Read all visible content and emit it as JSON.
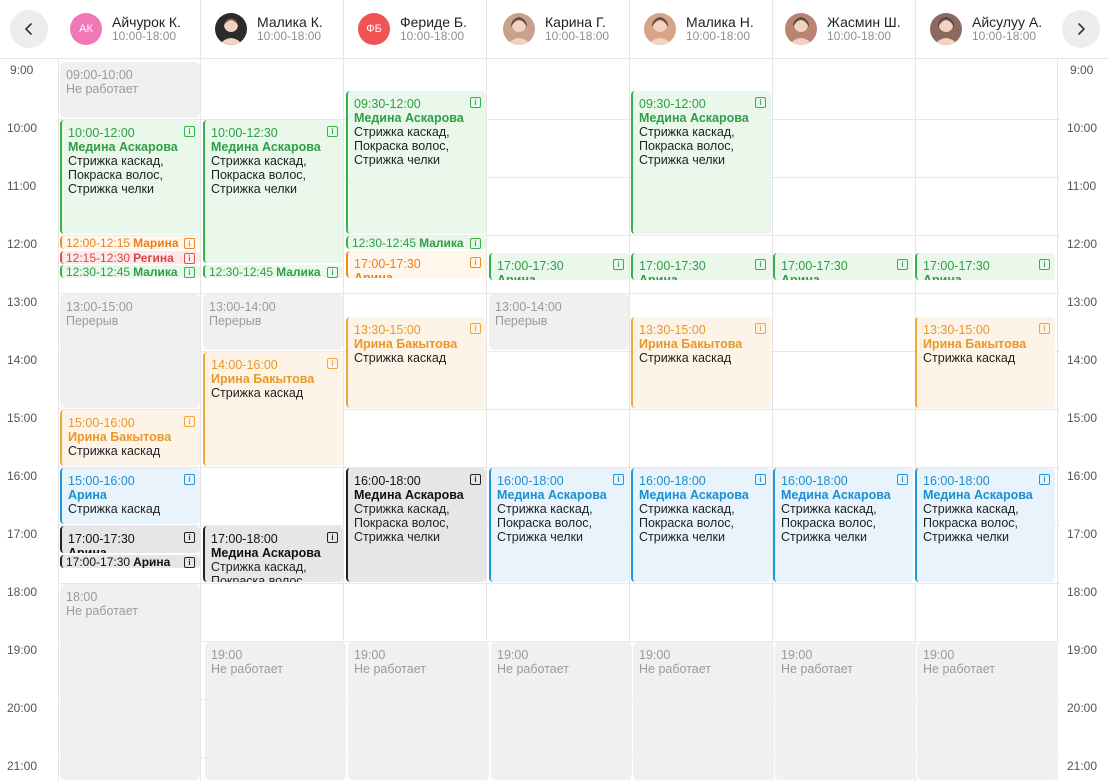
{
  "nav": {
    "prev_icon": "chevron-left-icon",
    "next_icon": "chevron-right-icon"
  },
  "staff": [
    {
      "name": "Айчурок К.",
      "hours": "10:00-18:00",
      "initials": "АК",
      "avatar_color": "#f178b6"
    },
    {
      "name": "Малика К.",
      "hours": "10:00-18:00",
      "initials": "",
      "avatar_color": "#2b2b2b"
    },
    {
      "name": "Фериде Б.",
      "hours": "10:00-18:00",
      "initials": "ФБ",
      "avatar_color": "#f05454"
    },
    {
      "name": "Карина Г.",
      "hours": "10:00-18:00",
      "initials": "",
      "avatar_color": "#c9a089"
    },
    {
      "name": "Малика Н.",
      "hours": "10:00-18:00",
      "initials": "",
      "avatar_color": "#d9a38a"
    },
    {
      "name": "Жасмин Ш.",
      "hours": "10:00-18:00",
      "initials": "",
      "avatar_color": "#b98572"
    },
    {
      "name": "Айсулуу А.",
      "hours": "10:00-18:00",
      "initials": "",
      "avatar_color": "#8e6a5e"
    }
  ],
  "times": [
    "9:00",
    "10:00",
    "11:00",
    "12:00",
    "13:00",
    "14:00",
    "15:00",
    "16:00",
    "17:00",
    "18:00",
    "19:00",
    "20:00",
    "21:00"
  ],
  "events": [
    {
      "col": 0,
      "start": 9.0,
      "end": 10.0,
      "type": "gray",
      "time": "09:00-10:00",
      "name": "Не работает",
      "service": ""
    },
    {
      "col": 0,
      "start": 10.0,
      "end": 12.0,
      "type": "green",
      "time": "10:00-12:00",
      "name": "Медина Аскарова",
      "service": "Стрижка каскад, Покраска волос, Стрижка челки"
    },
    {
      "col": 0,
      "start": 12.0,
      "end": 12.25,
      "type": "orange2",
      "time": "12:00-12:15",
      "name": "Марина",
      "service": "",
      "inline": true
    },
    {
      "col": 0,
      "start": 12.25,
      "end": 12.5,
      "type": "red",
      "time": "12:15-12:30",
      "name": "Регина",
      "service": "",
      "inline": true
    },
    {
      "col": 0,
      "start": 12.5,
      "end": 12.75,
      "type": "green",
      "time": "12:30-12:45",
      "name": "Малика",
      "service": "",
      "inline": true
    },
    {
      "col": 0,
      "start": 13.0,
      "end": 15.0,
      "type": "gray",
      "time": "13:00-15:00",
      "name": "Перерыв",
      "service": ""
    },
    {
      "col": 0,
      "start": 15.0,
      "end": 16.0,
      "type": "orange",
      "time": "15:00-16:00",
      "name": "Ирина Бакытова",
      "service": "Стрижка каскад"
    },
    {
      "col": 0,
      "start": 16.0,
      "end": 17.0,
      "type": "blue",
      "time": "15:00-16:00",
      "name": "Арина",
      "service": "Стрижка каскад"
    },
    {
      "col": 0,
      "start": 17.0,
      "end": 17.5,
      "type": "dark",
      "time": "17:00-17:30",
      "name": "Арина",
      "service": ""
    },
    {
      "col": 0,
      "start": 17.5,
      "end": 17.75,
      "type": "dark",
      "time": "17:00-17:30",
      "name": "Арина",
      "service": "",
      "inline": true
    },
    {
      "col": 0,
      "start": 18.0,
      "end": 21.5,
      "type": "gray",
      "time": "18:00",
      "name": "Не работает",
      "service": ""
    },
    {
      "col": 1,
      "start": 10.0,
      "end": 12.5,
      "type": "green",
      "time": "10:00-12:30",
      "name": "Медина Аскарова",
      "service": "Стрижка каскад, Покраска волос, Стрижка челки"
    },
    {
      "col": 1,
      "start": 12.5,
      "end": 12.75,
      "type": "green",
      "time": "12:30-12:45",
      "name": "Малика",
      "service": "",
      "inline": true
    },
    {
      "col": 1,
      "start": 13.0,
      "end": 14.0,
      "type": "gray",
      "time": "13:00-14:00",
      "name": "Перерыв",
      "service": ""
    },
    {
      "col": 1,
      "start": 14.0,
      "end": 16.0,
      "type": "orange",
      "time": "14:00-16:00",
      "name": "Ирина Бакытова",
      "service": "Стрижка каскад"
    },
    {
      "col": 1,
      "start": 17.0,
      "end": 18.0,
      "type": "dark",
      "time": "17:00-18:00",
      "name": "Медина Аскарова",
      "service": "Стрижка каскад, Покраска волос, Стрижка челки"
    },
    {
      "col": 1,
      "start": 19.0,
      "end": 21.5,
      "type": "gray",
      "time": "19:00",
      "name": "Не работает",
      "service": ""
    },
    {
      "col": 2,
      "start": 9.5,
      "end": 12.0,
      "type": "green",
      "time": "09:30-12:00",
      "name": "Медина Аскарова",
      "service": "Стрижка каскад, Покраска волос, Стрижка челки"
    },
    {
      "col": 2,
      "start": 12.0,
      "end": 12.25,
      "type": "green",
      "time": "12:30-12:45",
      "name": "Малика",
      "service": "",
      "inline": true
    },
    {
      "col": 2,
      "start": 12.25,
      "end": 12.75,
      "type": "orange2",
      "time": "17:00-17:30",
      "name": "Арина",
      "service": ""
    },
    {
      "col": 2,
      "start": 13.4,
      "end": 15.0,
      "type": "orange",
      "time": "13:30-15:00",
      "name": "Ирина Бакытова",
      "service": "Стрижка каскад"
    },
    {
      "col": 2,
      "start": 16.0,
      "end": 18.0,
      "type": "dark",
      "time": "16:00-18:00",
      "name": "Медина Аскарова",
      "service": "Стрижка каскад, Покраска волос, Стрижка челки"
    },
    {
      "col": 2,
      "start": 19.0,
      "end": 21.5,
      "type": "gray",
      "time": "19:00",
      "name": "Не работает",
      "service": ""
    },
    {
      "col": 3,
      "start": 12.3,
      "end": 12.8,
      "type": "green",
      "time": "17:00-17:30",
      "name": "Арина",
      "service": ""
    },
    {
      "col": 3,
      "start": 13.0,
      "end": 14.0,
      "type": "gray",
      "time": "13:00-14:00",
      "name": "Перерыв",
      "service": ""
    },
    {
      "col": 3,
      "start": 16.0,
      "end": 18.0,
      "type": "blue",
      "time": "16:00-18:00",
      "name": "Медина Аскарова",
      "service": "Стрижка каскад, Покраска волос, Стрижка челки"
    },
    {
      "col": 3,
      "start": 19.0,
      "end": 21.5,
      "type": "gray",
      "time": "19:00",
      "name": "Не работает",
      "service": ""
    },
    {
      "col": 4,
      "start": 9.5,
      "end": 12.0,
      "type": "green",
      "time": "09:30-12:00",
      "name": "Медина Аскарова",
      "service": "Стрижка каскад, Покраска волос, Стрижка челки"
    },
    {
      "col": 4,
      "start": 12.3,
      "end": 12.8,
      "type": "green",
      "time": "17:00-17:30",
      "name": "Арина",
      "service": ""
    },
    {
      "col": 4,
      "start": 13.4,
      "end": 15.0,
      "type": "orange",
      "time": "13:30-15:00",
      "name": "Ирина Бакытова",
      "service": "Стрижка каскад"
    },
    {
      "col": 4,
      "start": 16.0,
      "end": 18.0,
      "type": "blue",
      "time": "16:00-18:00",
      "name": "Медина Аскарова",
      "service": "Стрижка каскад, Покраска волос, Стрижка челки"
    },
    {
      "col": 4,
      "start": 19.0,
      "end": 21.5,
      "type": "gray",
      "time": "19:00",
      "name": "Не работает",
      "service": ""
    },
    {
      "col": 5,
      "start": 12.3,
      "end": 12.8,
      "type": "green",
      "time": "17:00-17:30",
      "name": "Арина",
      "service": ""
    },
    {
      "col": 5,
      "start": 16.0,
      "end": 18.0,
      "type": "blue",
      "time": "16:00-18:00",
      "name": "Медина Аскарова",
      "service": "Стрижка каскад, Покраска волос, Стрижка челки"
    },
    {
      "col": 5,
      "start": 19.0,
      "end": 21.5,
      "type": "gray",
      "time": "19:00",
      "name": "Не работает",
      "service": ""
    },
    {
      "col": 6,
      "start": 12.3,
      "end": 12.8,
      "type": "green",
      "time": "17:00-17:30",
      "name": "Арина",
      "service": ""
    },
    {
      "col": 6,
      "start": 13.4,
      "end": 15.0,
      "type": "orange",
      "time": "13:30-15:00",
      "name": "Ирина Бакытова",
      "service": "Стрижка каскад"
    },
    {
      "col": 6,
      "start": 16.0,
      "end": 18.0,
      "type": "blue",
      "time": "16:00-18:00",
      "name": "Медина Аскарова",
      "service": "Стрижка каскад, Покраска волос, Стрижка челки"
    },
    {
      "col": 6,
      "start": 19.0,
      "end": 21.5,
      "type": "gray",
      "time": "19:00",
      "name": "Не работает",
      "service": ""
    }
  ]
}
